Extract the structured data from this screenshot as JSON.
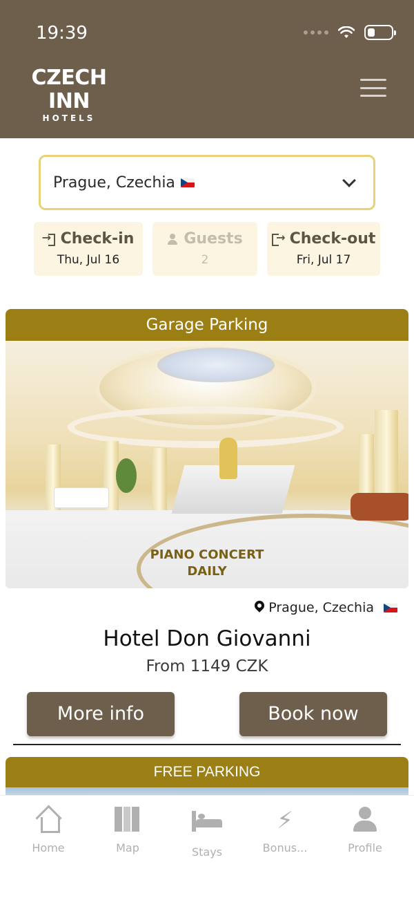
{
  "status_bar": {
    "time": "19:39"
  },
  "brand": {
    "name": "CZECH INN",
    "sub": "HOTELS"
  },
  "search": {
    "location": "Prague, Czechia"
  },
  "dates": {
    "checkin_label": "Check-in",
    "checkin_value": "Thu, Jul 16",
    "guests_label": "Guests",
    "guests_value": "2",
    "checkout_label": "Check-out",
    "checkout_value": "Fri, Jul 17"
  },
  "hotels": [
    {
      "banner": "Garage Parking",
      "photo_caption_line1": "PIANO CONCERT",
      "photo_caption_line2": "DAILY",
      "location": "Prague, Czechia",
      "name": "Hotel Don Giovanni",
      "price": "From 1149 CZK",
      "more_info_label": "More info",
      "book_label": "Book now"
    },
    {
      "banner": "FREE PARKING"
    }
  ],
  "tabs": [
    {
      "label": "Home",
      "icon": "home-icon"
    },
    {
      "label": "Map",
      "icon": "map-icon"
    },
    {
      "label": "Stays",
      "icon": "bed-icon"
    },
    {
      "label": "Bonus...",
      "icon": "lightning-icon"
    },
    {
      "label": "Profile",
      "icon": "person-icon"
    }
  ],
  "colors": {
    "header": "#6e5f4c",
    "accent_gold": "#9b7f15",
    "select_border": "#e7d27a",
    "chip_bg": "#fbf5e1",
    "tab_inactive": "#b0b0b0"
  }
}
